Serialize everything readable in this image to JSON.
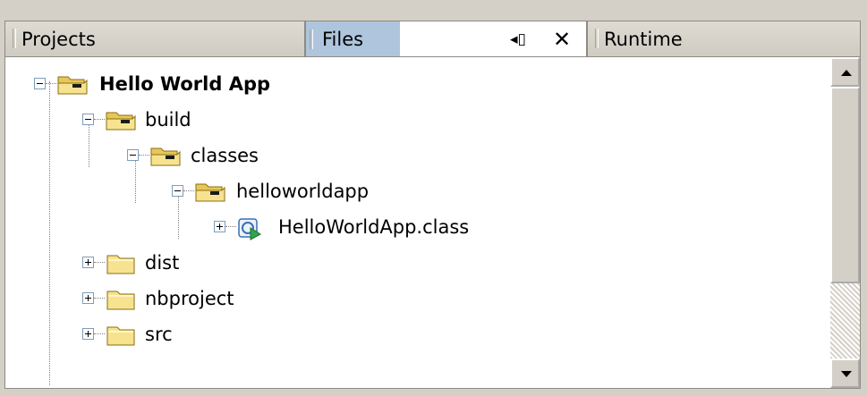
{
  "tabs": [
    {
      "label": "Projects",
      "active": false
    },
    {
      "label": "Files",
      "active": true
    },
    {
      "label": "Runtime",
      "active": false
    }
  ],
  "tab_controls": {
    "pin_icon": "minimize-window-icon",
    "pin_glyph": "◂▯",
    "close_glyph": "✕"
  },
  "tree": {
    "root": {
      "label": "Hello World App",
      "expanded": true
    },
    "build": {
      "label": "build",
      "expanded": true
    },
    "classes": {
      "label": "classes",
      "expanded": true
    },
    "helloworldapp": {
      "label": "helloworldapp",
      "expanded": true
    },
    "helloworldapp_class": {
      "label": "HelloWorldApp.class",
      "expanded": false
    },
    "dist": {
      "label": "dist",
      "expanded": false
    },
    "nbproject": {
      "label": "nbproject",
      "expanded": false
    },
    "src": {
      "label": "src",
      "expanded": false
    }
  },
  "colors": {
    "tab_selected_bg": "#aec5dd",
    "panel_bg": "#d4d0c8",
    "tree_bg": "#ffffff",
    "folder_fill": "#f7e38f",
    "folder_edge": "#8a6d12"
  }
}
